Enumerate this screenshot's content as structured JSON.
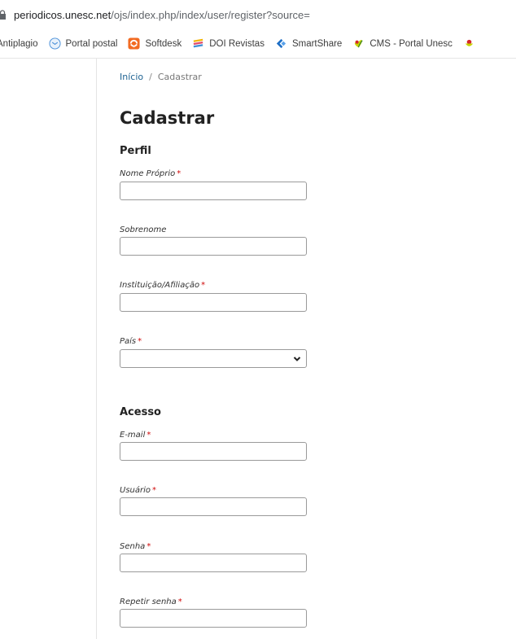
{
  "browser": {
    "url_domain": "periodicos.unesc.net",
    "url_path": "/ojs/index.php/index/user/register?source=",
    "bookmarks": [
      {
        "label": "Antiplagio",
        "icon": "blank-icon"
      },
      {
        "label": "Portal postal",
        "icon": "mail-icon",
        "color": "#4a90d9"
      },
      {
        "label": "Softdesk",
        "icon": "softdesk-icon",
        "color": "#f26a21"
      },
      {
        "label": "DOI Revistas",
        "icon": "doi-icon",
        "color": "#f2b400"
      },
      {
        "label": "SmartShare",
        "icon": "smartshare-icon",
        "color": "#1f6fc5"
      },
      {
        "label": "CMS - Portal Unesc",
        "icon": "unesc-icon",
        "color": "#c8d400"
      }
    ]
  },
  "breadcrumb": {
    "home": "Início",
    "separator": "/",
    "current": "Cadastrar"
  },
  "page": {
    "title": "Cadastrar"
  },
  "sections": {
    "perfil": "Perfil",
    "acesso": "Acesso"
  },
  "fields": {
    "nome_proprio": {
      "label": "Nome Próprio",
      "required": "*",
      "value": ""
    },
    "sobrenome": {
      "label": "Sobrenome",
      "value": ""
    },
    "instituicao": {
      "label": "Instituição/Afiliação",
      "required": "*",
      "value": ""
    },
    "pais": {
      "label": "País",
      "required": "*",
      "selected": ""
    },
    "email": {
      "label": "E-mail",
      "required": "*",
      "value": ""
    },
    "usuario": {
      "label": "Usuário",
      "required": "*",
      "value": ""
    },
    "senha": {
      "label": "Senha",
      "required": "*",
      "value": ""
    },
    "repetir_senha": {
      "label": "Repetir senha",
      "required": "*",
      "value": ""
    }
  },
  "colors": {
    "link": "#1e6292",
    "required": "#d00a0a"
  }
}
